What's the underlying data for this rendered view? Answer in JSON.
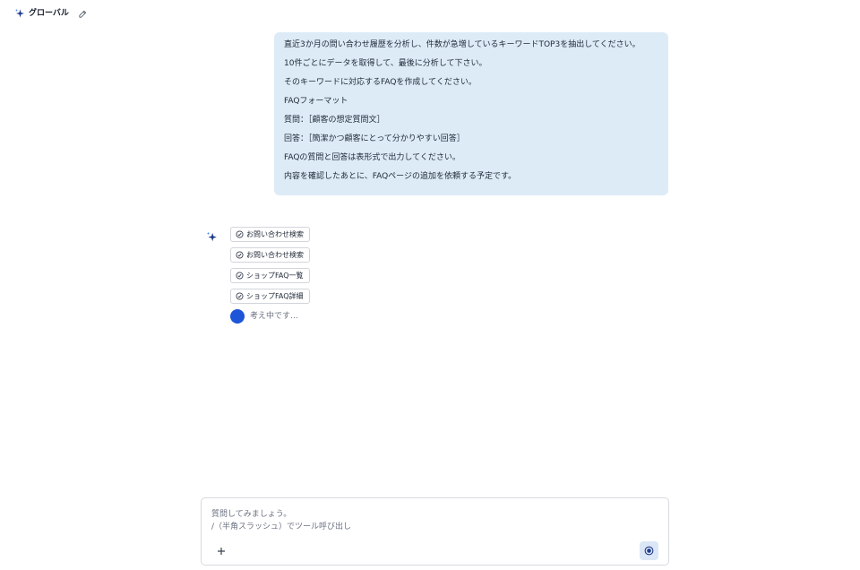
{
  "header": {
    "title": "グローバル"
  },
  "user_message": {
    "lines": [
      "直近3か月の問い合わせ履歴を分析し、件数が急増しているキーワードTOP3を抽出してください。",
      "10件ごとにデータを取得して、最後に分析して下さい。",
      "そのキーワードに対応するFAQを作成してください。",
      "FAQフォーマット",
      "質問：［顧客の想定質問文］",
      "回答：［簡潔かつ顧客にとって分かりやすい回答］",
      "FAQの質問と回答は表形式で出力してください。",
      "内容を確認したあとに、FAQページの追加を依頼する予定です。"
    ]
  },
  "assistant": {
    "tools": [
      "お問い合わせ検索",
      "お問い合わせ検索",
      "ショップFAQ一覧",
      "ショップFAQ詳細"
    ],
    "status": "考え中です…"
  },
  "composer": {
    "placeholder": "質問してみましょう。\n/（半角スラッシュ）でツール呼び出し"
  },
  "colors": {
    "bubble_bg": "#ddebf7",
    "accent": "#1d55d8"
  }
}
